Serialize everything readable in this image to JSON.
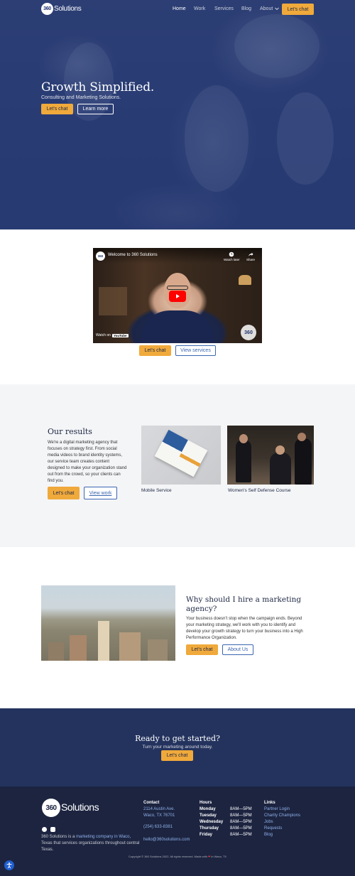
{
  "brand": {
    "logo_mark": "360",
    "logo_word": "Solutions"
  },
  "nav": {
    "items": [
      {
        "label": "Home"
      },
      {
        "label": "Work"
      },
      {
        "label": "Services"
      },
      {
        "label": "Blog"
      },
      {
        "label": "About"
      }
    ],
    "about_icon": "chevron-down-icon",
    "cta_label": "Let's chat"
  },
  "hero": {
    "title": "Growth Simplified.",
    "subtitle": "Consulting and Marketing Solutions.",
    "primary_label": "Let's chat",
    "secondary_label": "Learn more"
  },
  "video": {
    "channel_mark": "360",
    "title": "Welcome to 360 Solutions",
    "watch_later_label": "Watch later",
    "share_label": "Share",
    "watch_on_label": "Watch on",
    "youtube_label": "YouTube",
    "watermark_mark": "360",
    "primary_label": "Let's chat",
    "secondary_label": "View services"
  },
  "results": {
    "title": "Our results",
    "body": "We're a digital marketing agency that focuses on strategy first. From social media videos to brand identity systems, our service team creates content designed to make your organization stand out from the crowd, so your clients can find you.",
    "primary_label": "Let's chat",
    "secondary_label": "View work",
    "cards": [
      {
        "label": "Mobile Service"
      },
      {
        "label": "Women's Self Defense Course"
      }
    ]
  },
  "why": {
    "title": "Why should I hire a marketing agency?",
    "body": "Your business doesn't stop when the campaign ends. Beyond your marketing strategy, we'll work with you to identify and develop your growth strategy to turn your business into a High Performance Organization.",
    "primary_label": "Let's chat",
    "secondary_label": "About Us"
  },
  "cta": {
    "title": "Ready to get started?",
    "subtitle": "Turn your marketing around today.",
    "button_label": "Let's chat"
  },
  "footer": {
    "logo_mark": "360",
    "logo_word": "Solutions",
    "about_prefix": "360 Solutions is a ",
    "about_link": "marketing company in Waco",
    "about_suffix": ", Texas that services organizations throughout central Texas.",
    "contact_heading": "Contact",
    "address_line1": "2114 Austin Ave.",
    "address_line2": "Waco, TX 76701",
    "phone": "(254) 633-8381",
    "email": "hello@360solutions.com",
    "hours_heading": "Hours",
    "hours": [
      {
        "day": "Monday",
        "time": "8AM—5PM"
      },
      {
        "day": "Tuesday",
        "time": "8AM—5PM"
      },
      {
        "day": "Wednesday",
        "time": "8AM—5PM"
      },
      {
        "day": "Thursday",
        "time": "8AM—5PM"
      },
      {
        "day": "Friday",
        "time": "8AM—5PM"
      }
    ],
    "links_heading": "Links",
    "links": [
      {
        "label": "Partner Login"
      },
      {
        "label": "Charity Champions"
      },
      {
        "label": "Jobs"
      },
      {
        "label": "Requests"
      },
      {
        "label": "Blog"
      }
    ],
    "copyright_prefix": "Copyright © 360 Solutions 2022. All rights reserved. Made with",
    "copyright_suffix": "in Waco, TX"
  },
  "colors": {
    "accent": "#f0a93b",
    "navy": "#24335e",
    "footer": "#1c2440",
    "link": "#3b66b0"
  },
  "icons": {
    "facebook": "facebook-icon",
    "instagram": "instagram-icon",
    "accessibility": "accessibility-icon",
    "play": "play-icon",
    "heart": "heart-icon"
  }
}
